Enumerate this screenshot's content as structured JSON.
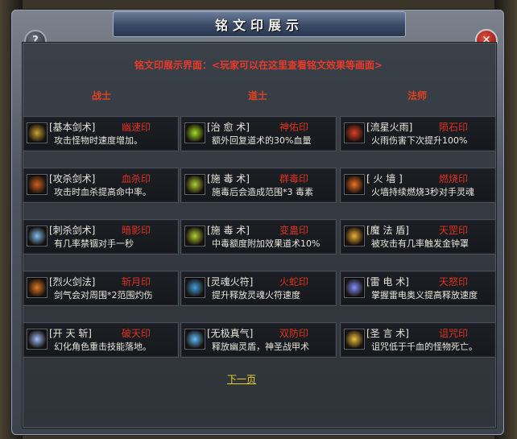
{
  "window": {
    "title": "铭文印展示"
  },
  "subtitle": "铭文印展示界面：<玩家可以在这里查看铭文效果等画面>",
  "columns": [
    {
      "header": "战士",
      "items": [
        {
          "name": "[基本剑术]",
          "tag": "幽速印",
          "desc": "攻击怪物时速度增加。",
          "icon": "sword-icon",
          "color": "#c8a030"
        },
        {
          "name": "[攻杀剑术]",
          "tag": "血杀印",
          "desc": "攻击时血杀提高命中率。",
          "icon": "blade-icon",
          "color": "#d06020"
        },
        {
          "name": "[刺杀剑术]",
          "tag": "暗影印",
          "desc": "有几率禁锢对手一秒",
          "icon": "wind-icon",
          "color": "#7fbff0"
        },
        {
          "name": "[烈火剑法]",
          "tag": "斩月印",
          "desc": "剑气会对周围*2范围灼伤",
          "icon": "flame-blade-icon",
          "color": "#e07a20"
        },
        {
          "name": "[开 天 斩]",
          "tag": "破天印",
          "desc": "幻化角色重击技能落地。",
          "icon": "slash-icon",
          "color": "#a0c0ff"
        }
      ]
    },
    {
      "header": "道士",
      "items": [
        {
          "name": "[治 愈 术]",
          "tag": "神佑印",
          "desc": "额外回复道术的30%血量",
          "icon": "heal-icon",
          "color": "#a0e020"
        },
        {
          "name": "[施 毒 术]",
          "tag": "群毒印",
          "desc": "施毒后会造成范围*3 毒素",
          "icon": "poison-icon",
          "color": "#b0d030"
        },
        {
          "name": "[施 毒 术]",
          "tag": "变蛊印",
          "desc": "中毒额度附加效果道术10%",
          "icon": "poison-icon",
          "color": "#b0d030"
        },
        {
          "name": "[灵魂火符]",
          "tag": "火蛇印",
          "desc": "提升释放灵魂火符速度",
          "icon": "talisman-icon",
          "color": "#40a0e0"
        },
        {
          "name": "[无极真气]",
          "tag": "双防印",
          "desc": "释放幽灵盾，神圣战甲术",
          "icon": "aura-icon",
          "color": "#60c0ff"
        }
      ]
    },
    {
      "header": "法师",
      "items": [
        {
          "name": "[流星火雨]",
          "tag": "陨石印",
          "desc": "火雨伤害下次提升100%",
          "icon": "meteor-icon",
          "color": "#e04020"
        },
        {
          "name": "[ 火 墙 ]",
          "tag": "燃烧印",
          "desc": "火墙持续燃烧3秒对手灵魂",
          "icon": "firewall-icon",
          "color": "#f07020"
        },
        {
          "name": "[魔 法 盾]",
          "tag": "天罡印",
          "desc": "被攻击有几率触发金钟罩",
          "icon": "shield-icon",
          "color": "#f0b030"
        },
        {
          "name": "[雷 电 术]",
          "tag": "天怒印",
          "desc": "掌握雷电奥义提高释放速度",
          "icon": "lightning-icon",
          "color": "#8090ff"
        },
        {
          "name": "[圣 言 术]",
          "tag": "诅咒印",
          "desc": "诅咒低于千血的怪物死亡。",
          "icon": "holy-icon",
          "color": "#f0c040"
        }
      ]
    }
  ],
  "footer": {
    "next_page": "下一页"
  }
}
